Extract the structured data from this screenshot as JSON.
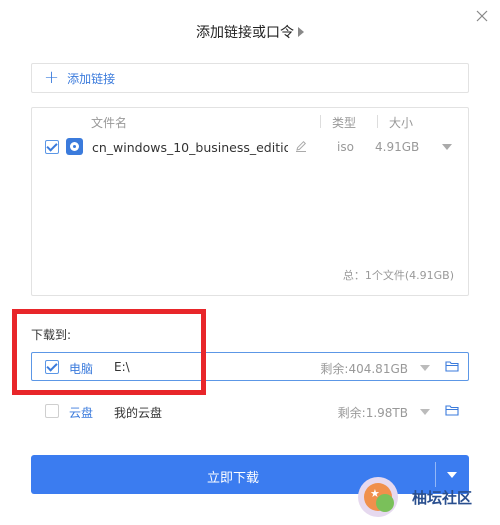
{
  "dialog": {
    "title": "添加链接或口令"
  },
  "add_link": {
    "label": "添加链接"
  },
  "file_list": {
    "columns": {
      "name": "文件名",
      "type": "类型",
      "size": "大小"
    },
    "files": [
      {
        "checked": true,
        "name": "cn_windows_10_business_editio",
        "type": "iso",
        "size": "4.91GB"
      }
    ],
    "summary": "总：1个文件(4.91GB)"
  },
  "download_to": {
    "label": "下载到:",
    "options": [
      {
        "checked": true,
        "name": "电脑",
        "path": "E:\\",
        "free": "剩余:404.81GB"
      },
      {
        "checked": false,
        "name": "云盘",
        "path": "我的云盘",
        "free": "剩余:1.98TB"
      }
    ]
  },
  "download_button": {
    "label": "立即下载"
  },
  "watermark": {
    "text": "柚坛社区"
  },
  "colors": {
    "accent": "#3b7cf0",
    "link": "#3b7bdc",
    "annotation": "#e8262a"
  }
}
